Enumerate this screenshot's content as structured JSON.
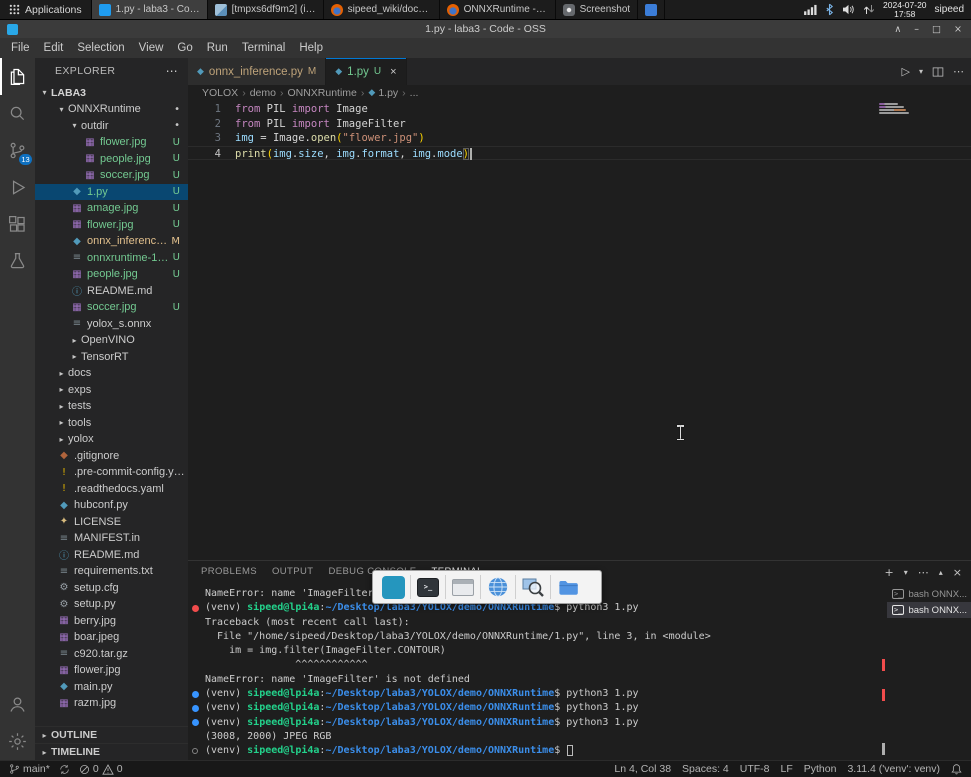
{
  "taskbar": {
    "applications_label": "Applications",
    "windows": [
      {
        "label": "1.py - laba3 - Code -...",
        "icon": "vscode",
        "active": true
      },
      {
        "label": "[tmpxs6df9m2] (im...",
        "icon": "image-viewer",
        "active": false
      },
      {
        "label": "sipeed_wiki/docs/h...",
        "icon": "browser",
        "active": false
      },
      {
        "label": "ONNXRuntime - Th...",
        "icon": "browser",
        "active": false
      },
      {
        "label": "Screenshot",
        "icon": "screenshot",
        "active": false
      },
      {
        "label": "",
        "icon": "file-manager",
        "active": false
      }
    ],
    "tray": {
      "date": "2024-07-20",
      "time": "17:58",
      "user": "sipeed"
    }
  },
  "titlebar": {
    "title": "1.py - laba3 - Code - OSS"
  },
  "menubar": {
    "items": [
      "File",
      "Edit",
      "Selection",
      "View",
      "Go",
      "Run",
      "Terminal",
      "Help"
    ]
  },
  "activity_bar": {
    "scm_badge": "13"
  },
  "sidebar": {
    "header": "EXPLORER",
    "section_label": "LABA3",
    "items": [
      {
        "label": "ONNXRuntime",
        "lvl": 1,
        "kind": "folder-open",
        "badge": "•"
      },
      {
        "label": "outdir",
        "lvl": 2,
        "kind": "folder-open",
        "badge": "•"
      },
      {
        "label": "flower.jpg",
        "lvl": 3,
        "icon": "image",
        "badge": "U",
        "git": "u"
      },
      {
        "label": "people.jpg",
        "lvl": 3,
        "icon": "image",
        "badge": "U",
        "git": "u"
      },
      {
        "label": "soccer.jpg",
        "lvl": 3,
        "icon": "image",
        "badge": "U",
        "git": "u"
      },
      {
        "label": "1.py",
        "lvl": 2,
        "icon": "python",
        "badge": "U",
        "git": "u",
        "selected": true
      },
      {
        "label": "amage.jpg",
        "lvl": 2,
        "icon": "image",
        "badge": "U",
        "git": "u"
      },
      {
        "label": "flower.jpg",
        "lvl": 2,
        "icon": "image",
        "badge": "U",
        "git": "u"
      },
      {
        "label": "onnx_inference....",
        "lvl": 2,
        "icon": "python",
        "badge": "M",
        "git": "m"
      },
      {
        "label": "onnxruntime-1....",
        "lvl": 2,
        "icon": "file",
        "badge": "U",
        "git": "u"
      },
      {
        "label": "people.jpg",
        "lvl": 2,
        "icon": "image",
        "badge": "U",
        "git": "u"
      },
      {
        "label": "README.md",
        "lvl": 2,
        "icon": "info"
      },
      {
        "label": "soccer.jpg",
        "lvl": 2,
        "icon": "image",
        "badge": "U",
        "git": "u"
      },
      {
        "label": "yolox_s.onnx",
        "lvl": 2,
        "icon": "file"
      },
      {
        "label": "OpenVINO",
        "lvl": 2,
        "kind": "folder-closed"
      },
      {
        "label": "TensorRT",
        "lvl": 2,
        "kind": "folder-closed"
      },
      {
        "label": "docs",
        "lvl": 1,
        "kind": "folder-closed"
      },
      {
        "label": "exps",
        "lvl": 1,
        "kind": "folder-closed"
      },
      {
        "label": "tests",
        "lvl": 1,
        "kind": "folder-closed"
      },
      {
        "label": "tools",
        "lvl": 1,
        "kind": "folder-closed"
      },
      {
        "label": "yolox",
        "lvl": 1,
        "kind": "folder-closed"
      },
      {
        "label": ".gitignore",
        "lvl": 1,
        "icon": "git"
      },
      {
        "label": ".pre-commit-config.yaml",
        "lvl": 1,
        "icon": "warn"
      },
      {
        "label": ".readthedocs.yaml",
        "lvl": 1,
        "icon": "warn"
      },
      {
        "label": "hubconf.py",
        "lvl": 1,
        "icon": "python"
      },
      {
        "label": "LICENSE",
        "lvl": 1,
        "icon": "key"
      },
      {
        "label": "MANIFEST.in",
        "lvl": 1,
        "icon": "file"
      },
      {
        "label": "README.md",
        "lvl": 1,
        "icon": "info"
      },
      {
        "label": "requirements.txt",
        "lvl": 1,
        "icon": "file"
      },
      {
        "label": "setup.cfg",
        "lvl": 1,
        "icon": "gear"
      },
      {
        "label": "setup.py",
        "lvl": 1,
        "icon": "gear"
      },
      {
        "label": "berry.jpg",
        "lvl": 1,
        "icon": "image"
      },
      {
        "label": "boar.jpeg",
        "lvl": 1,
        "icon": "image"
      },
      {
        "label": "c920.tar.gz",
        "lvl": 1,
        "icon": "file"
      },
      {
        "label": "flower.jpg",
        "lvl": 1,
        "icon": "image"
      },
      {
        "label": "main.py",
        "lvl": 1,
        "icon": "python"
      },
      {
        "label": "razm.jpg",
        "lvl": 1,
        "icon": "image"
      }
    ],
    "bottom_sections": [
      "OUTLINE",
      "TIMELINE"
    ]
  },
  "editor": {
    "tabs": [
      {
        "label": "onnx_inference.py",
        "badge": "M",
        "git": "m",
        "active": false
      },
      {
        "label": "1.py",
        "badge": "U",
        "git": "u",
        "active": true
      }
    ],
    "breadcrumbs": [
      {
        "label": "YOLOX"
      },
      {
        "label": "demo"
      },
      {
        "label": "ONNXRuntime"
      },
      {
        "label": "1.py",
        "icon": "python"
      },
      {
        "label": "..."
      }
    ],
    "code": [
      {
        "num": "1",
        "tokens": [
          [
            "kw",
            "from"
          ],
          [
            "pl",
            " PIL "
          ],
          [
            "kw",
            "import"
          ],
          [
            "pl",
            " Image"
          ]
        ]
      },
      {
        "num": "2",
        "tokens": [
          [
            "kw",
            "from"
          ],
          [
            "pl",
            " PIL "
          ],
          [
            "kw",
            "import"
          ],
          [
            "pl",
            " ImageFilter"
          ]
        ]
      },
      {
        "num": "3",
        "tokens": [
          [
            "var",
            "img"
          ],
          [
            "pl",
            " = "
          ],
          [
            "pl",
            "Image"
          ],
          [
            "pl",
            "."
          ],
          [
            "fn",
            "open"
          ],
          [
            "br",
            "("
          ],
          [
            "str",
            "\"flower.jpg\""
          ],
          [
            "br",
            ")"
          ]
        ]
      },
      {
        "num": "4",
        "current": true,
        "cursor": true,
        "tokens": [
          [
            "fn",
            "print"
          ],
          [
            "br",
            "("
          ],
          [
            "var",
            "img"
          ],
          [
            "pl",
            "."
          ],
          [
            "var",
            "size"
          ],
          [
            "pl",
            ", "
          ],
          [
            "var",
            "img"
          ],
          [
            "pl",
            "."
          ],
          [
            "var",
            "format"
          ],
          [
            "pl",
            ", "
          ],
          [
            "var",
            "img"
          ],
          [
            "pl",
            "."
          ],
          [
            "var",
            "mode"
          ],
          [
            "brm",
            ")"
          ]
        ]
      }
    ]
  },
  "panel": {
    "tabs": [
      {
        "label": "PROBLEMS"
      },
      {
        "label": "OUTPUT"
      },
      {
        "label": "DEBUG CONSOLE"
      },
      {
        "label": "TERMINAL",
        "active": true
      }
    ],
    "terminal": {
      "lines": [
        {
          "segs": [
            [
              "t",
              "NameError: name 'ImageFilter' is not defined"
            ]
          ]
        },
        {
          "marker": "err",
          "segs": [
            [
              "t",
              "(venv) "
            ],
            [
              "user",
              "sipeed@lpi4a"
            ],
            [
              "t",
              ":"
            ],
            [
              "path",
              "~/Desktop/laba3/YOLOX/demo/ONNXRuntime"
            ],
            [
              "t",
              "$ python3 1.py"
            ]
          ]
        },
        {
          "segs": [
            [
              "t",
              "Traceback (most recent call last):"
            ]
          ]
        },
        {
          "segs": [
            [
              "t",
              "  File \"/home/sipeed/Desktop/laba3/YOLOX/demo/ONNXRuntime/1.py\", line 3, in <module>"
            ]
          ]
        },
        {
          "segs": [
            [
              "t",
              "    im = img.filter(ImageFilter.CONTOUR)"
            ]
          ]
        },
        {
          "segs": [
            [
              "t",
              "               ^^^^^^^^^^^^"
            ]
          ]
        },
        {
          "segs": [
            [
              "t",
              "NameError: name 'ImageFilter' is not defined"
            ]
          ]
        },
        {
          "marker": "ok",
          "segs": [
            [
              "t",
              "(venv) "
            ],
            [
              "user",
              "sipeed@lpi4a"
            ],
            [
              "t",
              ":"
            ],
            [
              "path",
              "~/Desktop/laba3/YOLOX/demo/ONNXRuntime"
            ],
            [
              "t",
              "$ python3 1.py"
            ]
          ]
        },
        {
          "marker": "ok",
          "segs": [
            [
              "t",
              "(venv) "
            ],
            [
              "user",
              "sipeed@lpi4a"
            ],
            [
              "t",
              ":"
            ],
            [
              "path",
              "~/Desktop/laba3/YOLOX/demo/ONNXRuntime"
            ],
            [
              "t",
              "$ python3 1.py"
            ]
          ]
        },
        {
          "marker": "ok",
          "segs": [
            [
              "t",
              "(venv) "
            ],
            [
              "user",
              "sipeed@lpi4a"
            ],
            [
              "t",
              ":"
            ],
            [
              "path",
              "~/Desktop/laba3/YOLOX/demo/ONNXRuntime"
            ],
            [
              "t",
              "$ python3 1.py"
            ]
          ]
        },
        {
          "segs": [
            [
              "t",
              "(3008, 2000) JPEG RGB"
            ]
          ]
        },
        {
          "marker": "pending",
          "cursor": true,
          "segs": [
            [
              "t",
              "(venv) "
            ],
            [
              "user",
              "sipeed@lpi4a"
            ],
            [
              "t",
              ":"
            ],
            [
              "path",
              "~/Desktop/laba3/YOLOX/demo/ONNXRuntime"
            ],
            [
              "t",
              "$ "
            ]
          ]
        }
      ],
      "tabs": [
        {
          "label": "bash ONNX...",
          "active": false
        },
        {
          "label": "bash ONNX...",
          "active": true
        }
      ]
    }
  },
  "switcher": {
    "items": [
      "selected-app",
      "terminal",
      "window",
      "browser",
      "screenshot-tool",
      "file-manager"
    ]
  },
  "statusbar": {
    "branch": "main*",
    "errors": "0",
    "warnings": "0",
    "right_items": [
      "Ln 4, Col 38",
      "Spaces: 4",
      "UTF-8",
      "LF",
      "Python",
      "3.11.4 ('venv': venv)"
    ]
  },
  "glyphs": {
    "chevron_expanded": "▾",
    "chevron_collapsed": "▸",
    "breadcrumb_sep": "›",
    "more": "⋯",
    "plus": "+",
    "dropdown": "▾",
    "panel_maximize": "▴",
    "close": "×",
    "run": "▷",
    "shade": "∧",
    "minimize": "–",
    "maximize": "□",
    "tab_close": "×",
    "terminal_icon": ">_"
  },
  "colors": {
    "accent": "#0078d4",
    "git_untracked": "#73c991",
    "git_modified": "#e2c08d",
    "terminal_error_marker": "#f14c4c",
    "terminal_ok_marker": "#3794ff",
    "prompt_user": "#23d18b",
    "prompt_path": "#3b8eea",
    "selection": "#094771"
  }
}
